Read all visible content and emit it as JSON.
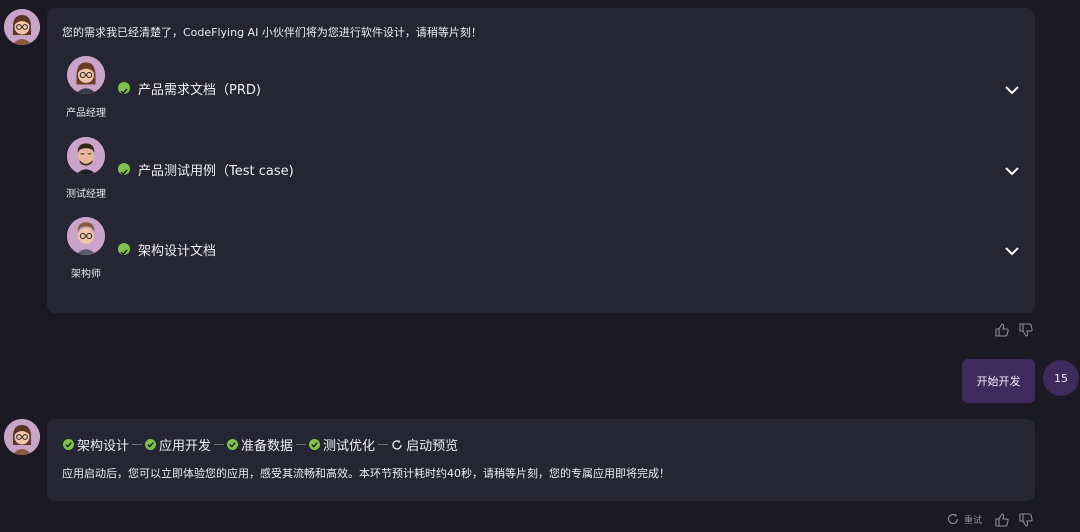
{
  "message1": {
    "intro": "您的需求我已经清楚了，CodeFlying AI 小伙伴们将为您进行软件设计，请稍等片刻！",
    "roles": [
      {
        "name": "产品经理",
        "document": "产品需求文档（PRD)"
      },
      {
        "name": "测试经理",
        "document": "产品测试用例（Test case)"
      },
      {
        "name": "架构师",
        "document": "架构设计文档"
      }
    ]
  },
  "user_message": {
    "text": "开始开发",
    "badge": "15"
  },
  "message2": {
    "steps": [
      {
        "label": "架构设计",
        "status": "done"
      },
      {
        "label": "应用开发",
        "status": "done"
      },
      {
        "label": "准备数据",
        "status": "done"
      },
      {
        "label": "测试优化",
        "status": "done"
      },
      {
        "label": "启动预览",
        "status": "in-progress"
      }
    ],
    "status_text": "应用启动后，您可以立即体验您的应用，感受其流畅和高效。本环节预计耗时约40秒，请稍等片刻，您的专属应用即将完成！",
    "retry_label": "重试"
  },
  "colors": {
    "background": "#1b1a24",
    "bubble": "#262533",
    "check": "#7ec24a",
    "user_bubble": "#3f2a5e"
  }
}
